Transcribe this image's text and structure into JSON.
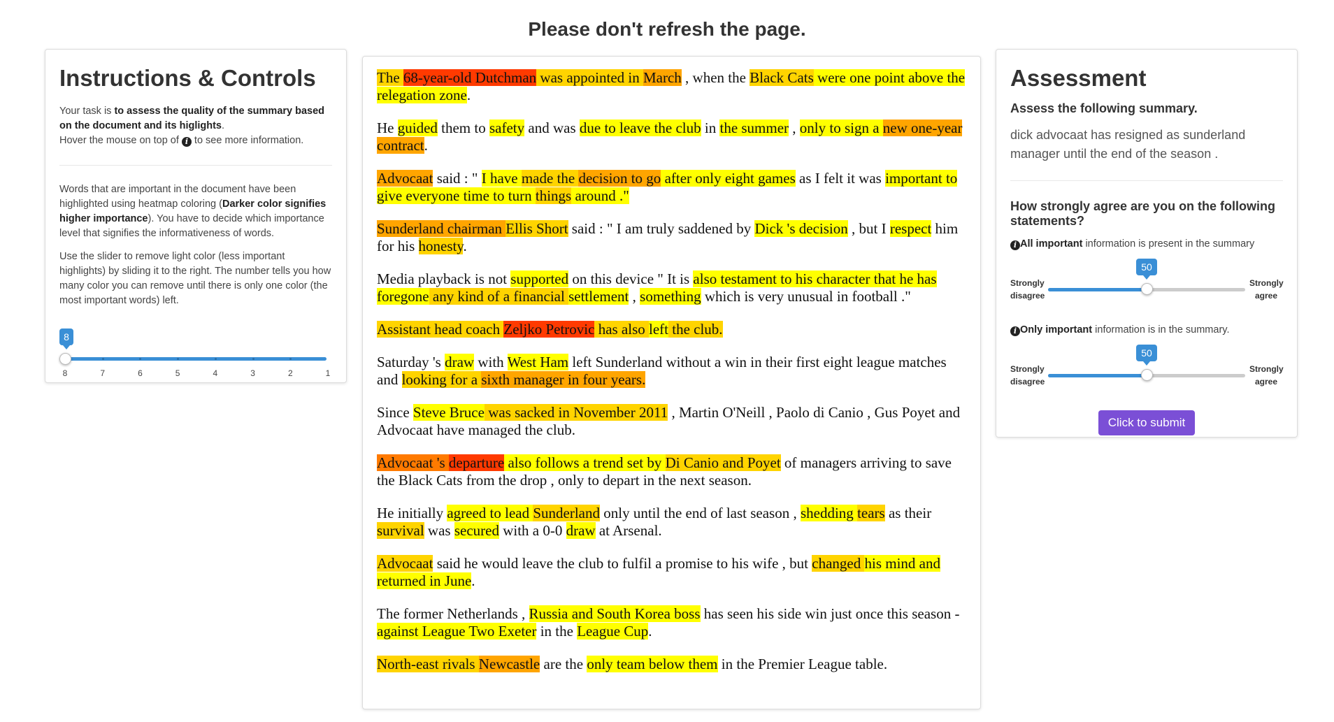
{
  "page_title": "Please don't refresh the page.",
  "left": {
    "title": "Instructions & Controls",
    "task_prefix": "Your task is ",
    "task_bold": "to assess the quality of the summary based on the document and its higlights",
    "task_suffix": ".",
    "hover_prefix": "Hover the mouse on top of ",
    "hover_suffix": " to see more information.",
    "p2_a": "Words that are important in the document have been highlighted using heatmap coloring (",
    "p2_bold": "Darker color signifies higher importance",
    "p2_b": "). You have to decide which importance level that signifies the informativeness of words.",
    "p3": "Use the slider to remove light color (less important highlights) by sliding it to the right. The number tells you how many color you can remove until there is only one color (the most important words) left.",
    "slider": {
      "value": 8,
      "value_label": "8",
      "ticks": [
        "8",
        "7",
        "6",
        "5",
        "4",
        "3",
        "2",
        "1"
      ]
    }
  },
  "document": {
    "paragraphs": [
      [
        [
          "The ",
          2
        ],
        [
          "68-year-old Dutchman",
          5
        ],
        [
          " was appointed in ",
          2
        ],
        [
          "March",
          3
        ],
        [
          " , when the ",
          0
        ],
        [
          "Black Cats",
          2
        ],
        [
          " were one point above the relegation zone",
          1
        ],
        [
          ".",
          0
        ]
      ],
      [
        [
          "He ",
          0
        ],
        [
          "guided",
          1
        ],
        [
          " them to ",
          0
        ],
        [
          "safety",
          1
        ],
        [
          " and was ",
          0
        ],
        [
          "due to leave the club",
          1
        ],
        [
          " in ",
          0
        ],
        [
          "the summer",
          1
        ],
        [
          " , ",
          0
        ],
        [
          "only to sign a ",
          1
        ],
        [
          "new one-year contract",
          3
        ],
        [
          ".",
          0
        ]
      ],
      [
        [
          "Advocaat",
          3
        ],
        [
          " said : \" ",
          0
        ],
        [
          "I have ",
          1
        ],
        [
          "made the ",
          2
        ],
        [
          "decision to go",
          3
        ],
        [
          " after ",
          1
        ],
        [
          "only eight games",
          1
        ],
        [
          " as I felt it was ",
          0
        ],
        [
          "important to give everyone time to turn ",
          1
        ],
        [
          "things",
          2
        ],
        [
          " around .\"",
          1
        ]
      ],
      [
        [
          "Sunderland chairman ",
          3
        ],
        [
          "Ellis Short",
          2
        ],
        [
          " said : \" I am truly saddened by ",
          0
        ],
        [
          "Dick 's decision",
          1
        ],
        [
          " , but I ",
          0
        ],
        [
          "respect",
          1
        ],
        [
          " him for his ",
          0
        ],
        [
          "honesty",
          2
        ],
        [
          ".",
          0
        ]
      ],
      [
        [
          "Media playback is not ",
          0
        ],
        [
          "supported",
          1
        ],
        [
          " on this device \" It is ",
          0
        ],
        [
          "also testament to his character that he has foregone",
          1
        ],
        [
          " any kind of a financial ",
          2
        ],
        [
          "settlement",
          1
        ],
        [
          " , ",
          0
        ],
        [
          "something",
          1
        ],
        [
          " which is very unusual in football .\"",
          0
        ]
      ],
      [
        [
          "Assistant head coach ",
          2
        ],
        [
          "Zeljko Petrovic",
          5
        ],
        [
          " has also ",
          2
        ],
        [
          "left",
          1
        ],
        [
          " the club.",
          2
        ]
      ],
      [
        [
          "Saturday 's ",
          0
        ],
        [
          "draw",
          1
        ],
        [
          " with ",
          0
        ],
        [
          "West Ham",
          1
        ],
        [
          " left Sunderland without a win in their first eight league matches and ",
          0
        ],
        [
          "looking for a ",
          2
        ],
        [
          "sixth manager",
          3
        ],
        [
          " in four years.",
          3
        ]
      ],
      [
        [
          "Since ",
          0
        ],
        [
          "Steve Bruce",
          1
        ],
        [
          " was sacked in November 2011",
          2
        ],
        [
          " , Martin O'Neill , Paolo di Canio , Gus Poyet and Advocaat have managed the club.",
          0
        ]
      ],
      [
        [
          "Advocaat 's ",
          4
        ],
        [
          "departure",
          5
        ],
        [
          " also follows a trend set by ",
          1
        ],
        [
          "Di Canio and Poyet",
          2
        ],
        [
          " of managers arriving to save the Black Cats from the drop , only to depart in the next season.",
          0
        ]
      ],
      [
        [
          "He initially ",
          0
        ],
        [
          "agreed to lead ",
          1
        ],
        [
          "Sunderland",
          2
        ],
        [
          " only until the end of last season , ",
          0
        ],
        [
          "shedding ",
          1
        ],
        [
          "tears",
          2
        ],
        [
          " as their ",
          0
        ],
        [
          "survival",
          2
        ],
        [
          " was ",
          0
        ],
        [
          "secured",
          1
        ],
        [
          " with a 0-0 ",
          0
        ],
        [
          "draw",
          1
        ],
        [
          " at Arsenal.",
          0
        ]
      ],
      [
        [
          "Advocaat",
          2
        ],
        [
          " said he would leave the club to fulfil a promise to his wife , but ",
          0
        ],
        [
          "changed ",
          2
        ],
        [
          "his mind and returned in June",
          1
        ],
        [
          ".",
          0
        ]
      ],
      [
        [
          "The former Netherlands , ",
          0
        ],
        [
          "Russia and South Korea boss",
          1
        ],
        [
          " has seen his side win just once this season - ",
          0
        ],
        [
          "against League Two Exeter",
          1
        ],
        [
          " in the ",
          0
        ],
        [
          "League Cup",
          1
        ],
        [
          ".",
          0
        ]
      ],
      [
        [
          "North-east rivals ",
          2
        ],
        [
          "Newcastle",
          3
        ],
        [
          " are the ",
          0
        ],
        [
          "only team below them",
          1
        ],
        [
          " in the Premier League table.",
          0
        ]
      ]
    ]
  },
  "right": {
    "title": "Assessment",
    "subtitle": "Assess the following summary.",
    "summary": "dick advocaat has resigned as sunderland manager until the end of the season .",
    "question": "How strongly agree are you on the following statements?",
    "statements": [
      {
        "bold": "All important",
        "rest": " information is present in the summary",
        "value": 50,
        "value_label": "50"
      },
      {
        "bold": "Only important",
        "rest": " information is in the summary.",
        "value": 50,
        "value_label": "50"
      }
    ],
    "left_label_1": "Strongly",
    "left_label_2": "disagree",
    "right_label_1": "Strongly",
    "right_label_2": "agree",
    "submit_label": "Click to submit"
  },
  "colors": {
    "slider_blue": "#3a8fd6",
    "submit_purple": "#7b4fd6",
    "heat_levels": [
      "#ffff00",
      "#ffd400",
      "#ffa500",
      "#ff7a00",
      "#ff3a00"
    ]
  },
  "icons": {
    "info": "info-circle-icon"
  }
}
